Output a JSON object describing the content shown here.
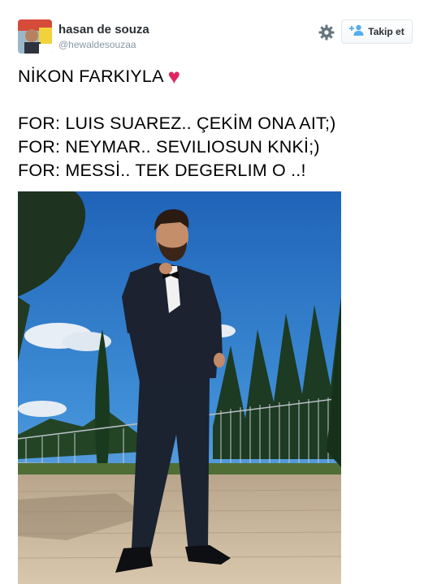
{
  "user": {
    "name": "hasan de souza",
    "handle": "@hewaldesouzaa"
  },
  "actions": {
    "follow_label": "Takip et"
  },
  "tweet": {
    "line1": "NİKON FARKIYLA",
    "heart": "♥",
    "line2": "FOR: LUIS SUAREZ.. ÇEKİM ONA AIT;)",
    "line3": "FOR: NEYMAR.. SEVILIOSUN KNKİ;)",
    "line4": "FOR: MESSİ.. TEK DEGERLIM O ..!"
  },
  "icons": {
    "settings": "gear-icon",
    "follow": "add-person-icon",
    "heart": "heart-icon"
  },
  "colors": {
    "heart": "#e0245e",
    "follow_icon": "#55acee",
    "handle": "#8899a6"
  }
}
